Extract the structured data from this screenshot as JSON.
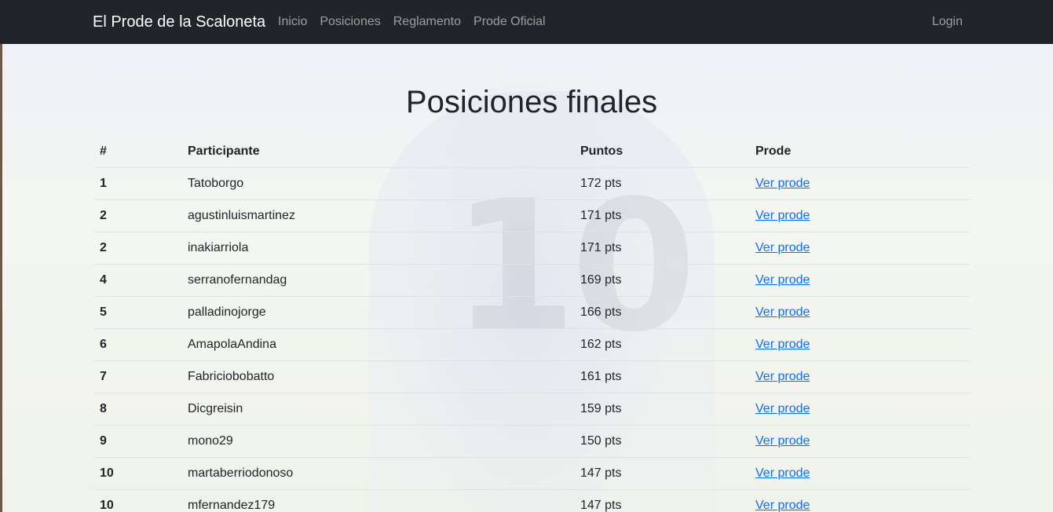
{
  "nav": {
    "brand": "El Prode de la Scaloneta",
    "links": [
      "Inicio",
      "Posiciones",
      "Reglamento",
      "Prode Oficial"
    ],
    "login": "Login"
  },
  "page": {
    "title": "Posiciones finales"
  },
  "table": {
    "headers": {
      "rank": "#",
      "name": "Participante",
      "points": "Puntos",
      "prode": "Prode"
    },
    "rows": [
      {
        "rank": "1",
        "name": "Tatoborgo",
        "points": "172 pts",
        "link": "Ver prode"
      },
      {
        "rank": "2",
        "name": "agustinluismartinez",
        "points": "171 pts",
        "link": "Ver prode"
      },
      {
        "rank": "2",
        "name": "inakiarriola",
        "points": "171 pts",
        "link": "Ver prode"
      },
      {
        "rank": "4",
        "name": "serranofernandag",
        "points": "169 pts",
        "link": "Ver prode"
      },
      {
        "rank": "5",
        "name": "palladinojorge",
        "points": "166 pts",
        "link": "Ver prode"
      },
      {
        "rank": "6",
        "name": "AmapolaAndina",
        "points": "162 pts",
        "link": "Ver prode"
      },
      {
        "rank": "7",
        "name": "Fabriciobobatto",
        "points": "161 pts",
        "link": "Ver prode"
      },
      {
        "rank": "8",
        "name": "Dicgreisin",
        "points": "159 pts",
        "link": "Ver prode"
      },
      {
        "rank": "9",
        "name": "mono29",
        "points": "150 pts",
        "link": "Ver prode"
      },
      {
        "rank": "10",
        "name": "martaberriodonoso",
        "points": "147 pts",
        "link": "Ver prode"
      },
      {
        "rank": "10",
        "name": "mfernandez179",
        "points": "147 pts",
        "link": "Ver prode"
      }
    ]
  },
  "colors": {
    "navbar": "#212529",
    "link": "#0d6efd",
    "text": "#212529"
  }
}
